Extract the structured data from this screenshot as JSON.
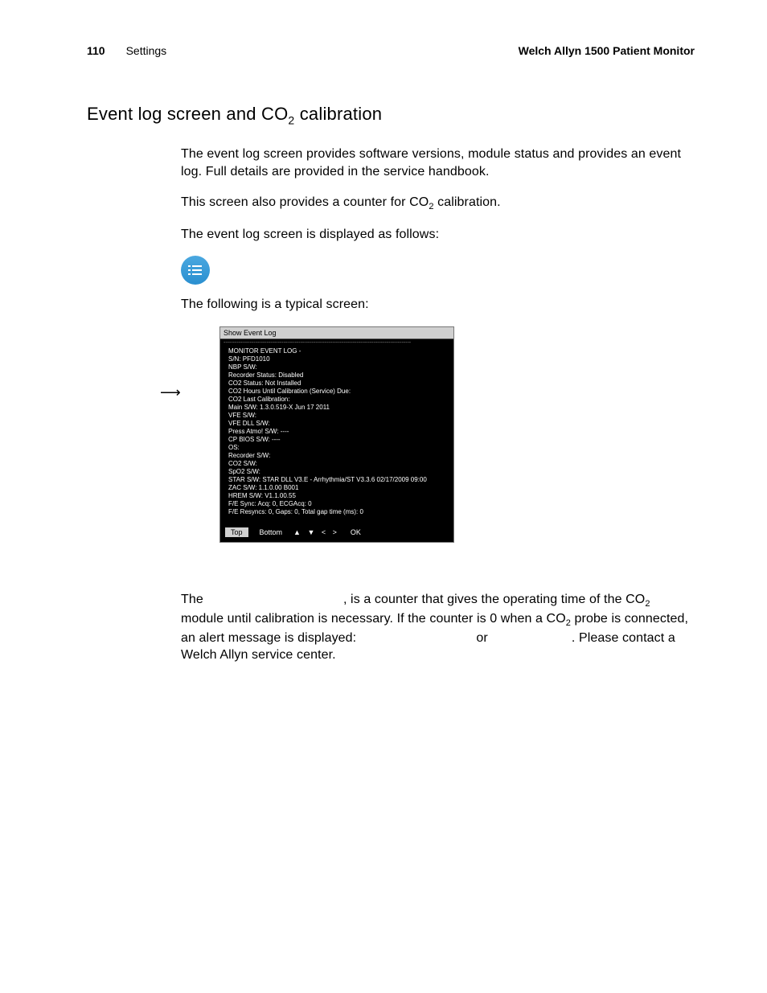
{
  "header": {
    "page_number": "110",
    "section": "Settings",
    "product": "Welch Allyn 1500 Patient Monitor"
  },
  "title_pre": "Event log screen and CO",
  "title_sub": "2",
  "title_post": " calibration",
  "p1": "The event log screen provides software versions, module status and provides an event log. Full details are provided in the service handbook.",
  "p2_pre": "This screen also provides a counter for CO",
  "p2_sub": "2",
  "p2_post": " calibration.",
  "p3": "The event log screen is displayed as follows:",
  "p4": "The following is a typical screen:",
  "monitor": {
    "title": "Show Event Log",
    "lines": [
      "MONITOR EVENT LOG -",
      "S/N: PFD1010",
      "NBP S/W:",
      "Recorder Status: Disabled",
      "CO2 Status: Not Installed",
      "CO2 Hours Until Calibration (Service) Due:",
      "CO2 Last Calibration:",
      "Main S/W: 1.3.0.519-X Jun 17 2011",
      "VFE S/W:",
      "VFE DLL S/W:",
      "Press Atmo! S/W: ----",
      "CP BIOS S/W: ----",
      "OS:",
      "Recorder S/W:",
      "CO2 S/W:",
      "SpO2 S/W:",
      "STAR S/W: STAR DLL V3.E - Arrhythmia/ST V3.3.6 02/17/2009 09:00",
      "ZAC S/W: 1.1.0.00 B001",
      "HREM S/W: V1.1.00.55",
      "F/E Sync: Acq: 0, ECGAcq: 0",
      "F/E Resyncs: 0, Gaps: 0, Total gap time (ms): 0"
    ],
    "footer": {
      "btn_top": "Top",
      "btn_bottom": "Bottom",
      "nav": "▲  ▼  <  >",
      "ok": "OK"
    }
  },
  "p5_a": "The ",
  "p5_b": ", is a counter that gives the operating time of the CO",
  "p5_b_sub": "2",
  "p5_c": " module until calibration is necessary. If the counter is 0 when a CO",
  "p5_c_sub": "2",
  "p5_d": " probe is connected, an alert message is displayed: ",
  "p5_e": " or ",
  "p5_f": ". Please contact a Welch Allyn service center."
}
